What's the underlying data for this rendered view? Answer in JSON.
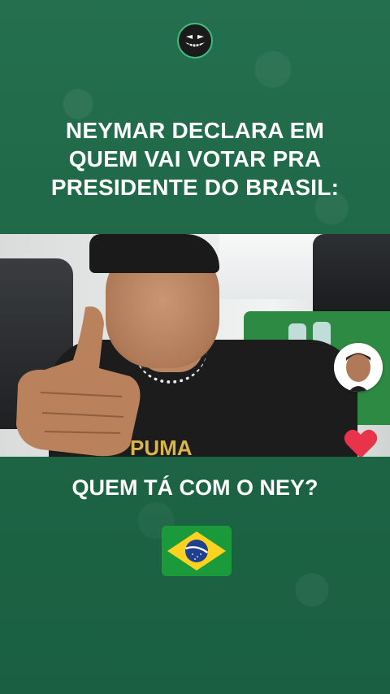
{
  "headline": {
    "lines": [
      "NEYMAR DECLARA EM",
      "QUEM VAI VOTAR PRA",
      "PRESIDENTE DO BRASIL:"
    ]
  },
  "video": {
    "shirt_text": "PUMA"
  },
  "question": "QUEM TÁ COM O NEY?",
  "icons": {
    "logo": "grinning-face-logo",
    "reaction": "heart-icon",
    "flag": "brazil-flag"
  },
  "colors": {
    "background": "#1f6b4a",
    "text": "#ffffff",
    "heart": "#e8334a",
    "flag_green": "#1a9a3b",
    "flag_yellow": "#ffd21f",
    "flag_blue": "#1f3f8f"
  }
}
